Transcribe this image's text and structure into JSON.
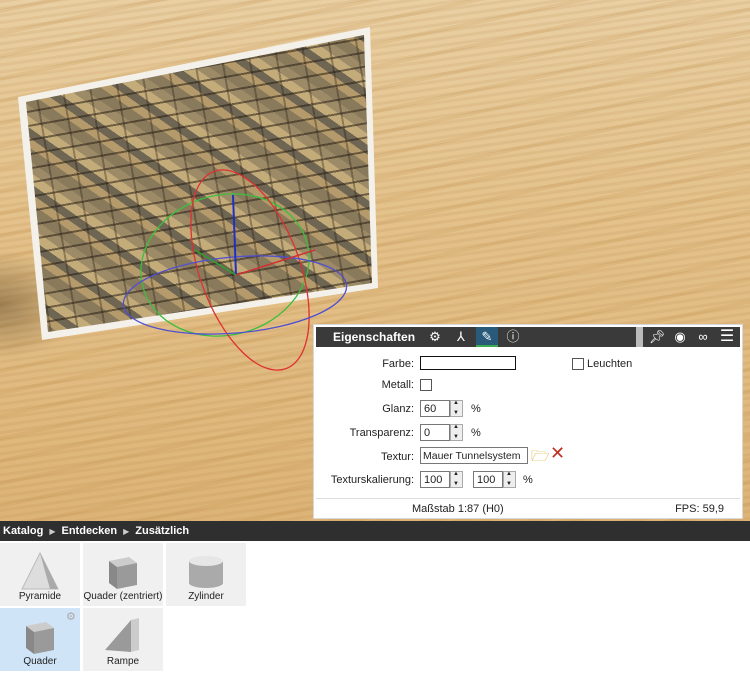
{
  "panel": {
    "title": "Eigenschaften",
    "tabs": [
      "settings-icon",
      "axes-icon",
      "paint-icon",
      "info-icon"
    ],
    "header_actions": [
      "pin-icon",
      "eye-icon",
      "link-icon",
      "menu-icon"
    ],
    "farbe_label": "Farbe:",
    "farbe_value": "",
    "leuchten_label": "Leuchten",
    "metall_label": "Metall:",
    "glanz_label": "Glanz:",
    "glanz_value": "60",
    "glanz_unit": "%",
    "transparenz_label": "Transparenz:",
    "transparenz_value": "0",
    "transparenz_unit": "%",
    "textur_label": "Textur:",
    "textur_value": "Mauer Tunnelsystem",
    "skalierung_label": "Texturskalierung:",
    "skalierung_x": "100",
    "skalierung_y": "100",
    "skalierung_unit": "%",
    "scale": "Maßstab 1:87 (H0)",
    "fps": "FPS: 59,9"
  },
  "breadcrumb": [
    "Katalog",
    "Entdecken",
    "Zusätzlich"
  ],
  "tiles": [
    {
      "label": "Pyramide"
    },
    {
      "label": "Quader (zentriert)"
    },
    {
      "label": "Zylinder"
    },
    {
      "label": "Quader"
    },
    {
      "label": "Rampe"
    }
  ],
  "colors": {
    "header": "#3a3a3a",
    "accent_tab": "#2a5a7a",
    "selected_tile": "#cfe5f7"
  }
}
